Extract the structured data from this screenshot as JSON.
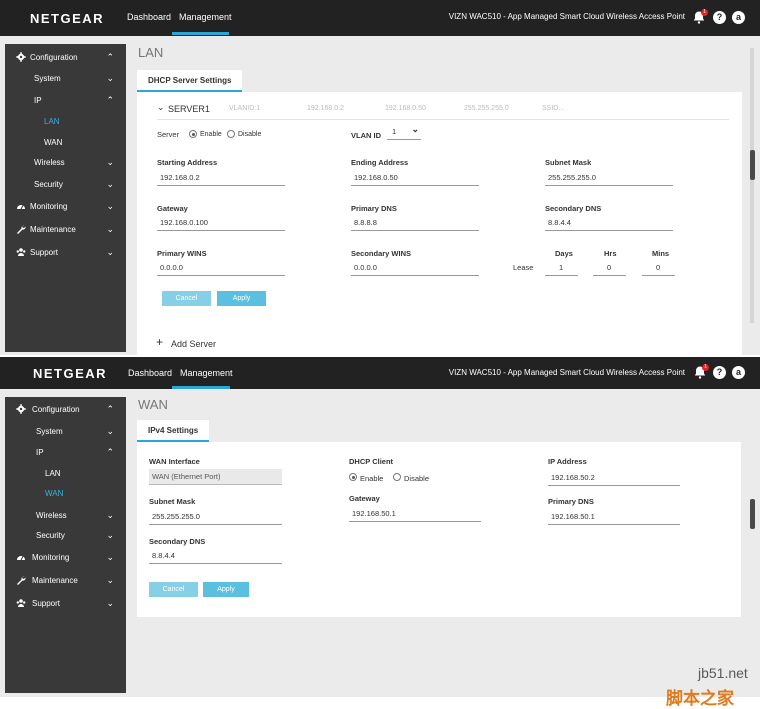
{
  "brand": "NETGEAR",
  "product_name": "VIZN WAC510 - App Managed Smart Cloud Wireless Access Point",
  "nav": {
    "dashboard": "Dashboard",
    "management": "Management"
  },
  "icons": {
    "notification_count": "1",
    "help": "?",
    "account": "a"
  },
  "colors": {
    "accent": "#2aa7d6",
    "topbar": "#222222",
    "sidebar": "#393939",
    "button": "#5bbfe0"
  },
  "sidebar": {
    "configuration": "Configuration",
    "system": "System",
    "ip": "IP",
    "lan": "LAN",
    "wan": "WAN",
    "wireless": "Wireless",
    "security": "Security",
    "monitoring": "Monitoring",
    "maintenance": "Maintenance",
    "support": "Support"
  },
  "lan_page": {
    "title": "LAN",
    "tab": "DHCP Server Settings",
    "server": {
      "name": "SERVER1",
      "summary": [
        "VLANID:1",
        "192.168.0.2",
        "192.168.0.50",
        "255.255.255.0",
        "SSID..."
      ]
    },
    "server_label": "Server",
    "enable": "Enable",
    "disable": "Disable",
    "vlan_id_label": "VLAN ID",
    "vlan_id_value": "1",
    "starting_address_label": "Starting Address",
    "starting_address": "192.168.0.2",
    "ending_address_label": "Ending Address",
    "ending_address": "192.168.0.50",
    "subnet_mask_label": "Subnet Mask",
    "subnet_mask": "255.255.255.0",
    "gateway_label": "Gateway",
    "gateway": "192.168.0.100",
    "primary_dns_label": "Primary DNS",
    "primary_dns": "8.8.8.8",
    "secondary_dns_label": "Secondary DNS",
    "secondary_dns": "8.8.4.4",
    "primary_wins_label": "Primary WINS",
    "primary_wins": "0.0.0.0",
    "secondary_wins_label": "Secondary WINS",
    "secondary_wins": "0.0.0.0",
    "lease_label": "Lease",
    "days_label": "Days",
    "hrs_label": "Hrs",
    "mins_label": "Mins",
    "days": "1",
    "hrs": "0",
    "mins": "0",
    "cancel": "Cancel",
    "apply": "Apply",
    "add_server": "Add Server"
  },
  "wan_page": {
    "title": "WAN",
    "tab": "IPv4 Settings",
    "wan_interface_label": "WAN Interface",
    "wan_interface": "WAN (Ethernet Port)",
    "dhcp_client_label": "DHCP Client",
    "enable": "Enable",
    "disable": "Disable",
    "ip_address_label": "IP Address",
    "ip_address": "192.168.50.2",
    "subnet_mask_label": "Subnet Mask",
    "subnet_mask": "255.255.255.0",
    "gateway_label": "Gateway",
    "gateway": "192.168.50.1",
    "primary_dns_label": "Primary DNS",
    "primary_dns": "192.168.50.1",
    "secondary_dns_label": "Secondary DNS",
    "secondary_dns": "8.8.4.4",
    "cancel": "Cancel",
    "apply": "Apply"
  },
  "watermark": {
    "site": "jb51.net",
    "name": "脚本之家"
  }
}
